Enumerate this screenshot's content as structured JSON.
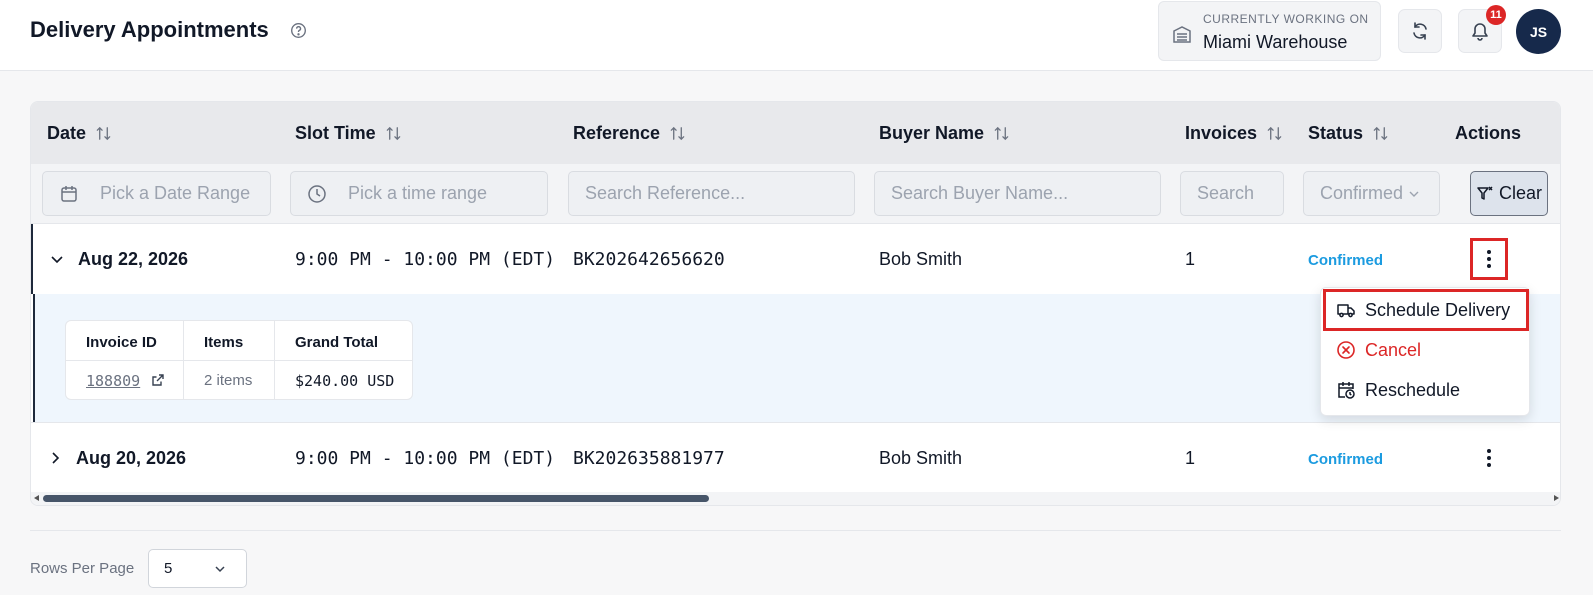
{
  "header": {
    "title": "Delivery Appointments",
    "warehouse_label": "CURRENTLY WORKING ON",
    "warehouse_name": "Miami Warehouse",
    "notification_count": "11",
    "avatar_initials": "JS"
  },
  "columns": [
    "Date",
    "Slot Time",
    "Reference",
    "Buyer Name",
    "Invoices",
    "Status",
    "Actions"
  ],
  "filters": {
    "date_placeholder": "Pick a Date Range",
    "time_placeholder": "Pick a time range",
    "reference_placeholder": "Search Reference...",
    "buyer_placeholder": "Search Buyer Name...",
    "invoices_placeholder": "Search",
    "status_value": "Confirmed",
    "clear_label": "Clear"
  },
  "rows": [
    {
      "date": "Aug 22, 2026",
      "slot": "9:00 PM - 10:00 PM (EDT)",
      "reference": "BK202642656620",
      "buyer": "Bob Smith",
      "invoices": "1",
      "status": "Confirmed",
      "expanded": true
    },
    {
      "date": "Aug 20, 2026",
      "slot": "9:00 PM - 10:00 PM (EDT)",
      "reference": "BK202635881977",
      "buyer": "Bob Smith",
      "invoices": "1",
      "status": "Confirmed",
      "expanded": false
    }
  ],
  "invoice_table": {
    "headers": [
      "Invoice ID",
      "Items",
      "Grand Total"
    ],
    "row": {
      "invoice_id": "188809",
      "items": "2 items",
      "grand_total": "$240.00 USD"
    }
  },
  "actions_menu": {
    "items": [
      {
        "label": "Schedule Delivery",
        "icon": "truck-icon"
      },
      {
        "label": "Cancel",
        "icon": "cancel-circle-icon"
      },
      {
        "label": "Reschedule",
        "icon": "calendar-clock-icon"
      }
    ]
  },
  "footer": {
    "rows_per_page_label": "Rows Per Page",
    "rows_per_page_value": "5"
  },
  "colors": {
    "accent_dark": "#16294b",
    "status_blue": "#1b9be0",
    "danger": "#dc2626"
  }
}
